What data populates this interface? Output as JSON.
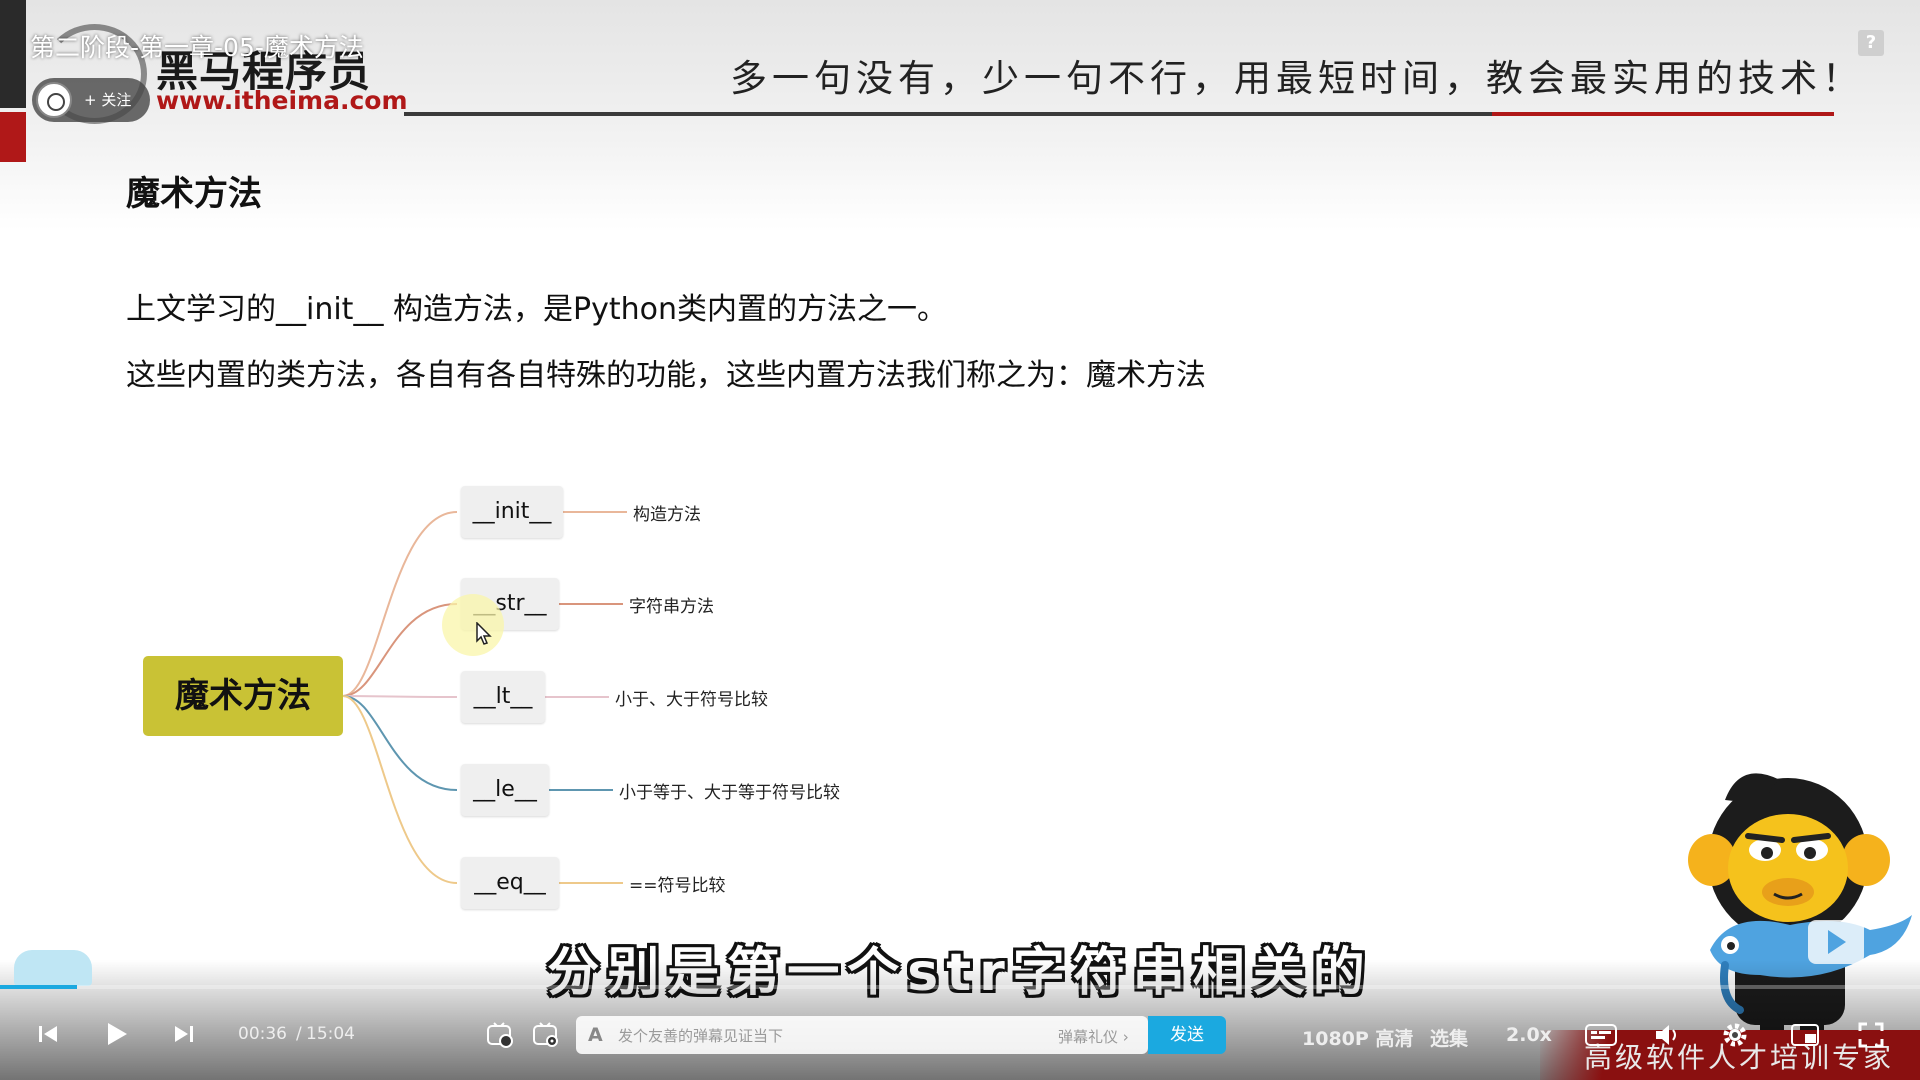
{
  "video": {
    "title": "第二阶段-第一章-05-魔术方法",
    "follow_label": "+ 关注"
  },
  "header": {
    "logo_brand": "黑马程序员",
    "logo_url": "www.itheima.com",
    "slogan": "多一句没有，少一句不行，用最短时间，教会最实用的技术！",
    "help_label": "?"
  },
  "slide": {
    "title": "魔术方法",
    "paragraph1": "上文学习的__init__ 构造方法，是Python类内置的方法之一。",
    "paragraph2": "这些内置的类方法，各自有各自特殊的功能，这些内置方法我们称之为：魔术方法",
    "mindmap": {
      "root": "魔术方法",
      "branches": [
        {
          "label": "__init__",
          "desc": "构造方法",
          "color": "#e9b79a"
        },
        {
          "label": "__str__",
          "desc": "字符串方法",
          "color": "#d9957c"
        },
        {
          "label": "__lt__",
          "desc": "小于、大于符号比较",
          "color": "#e6c4cc"
        },
        {
          "label": "__le__",
          "desc": "小于等于、大于等于符号比较",
          "color": "#5e96b0"
        },
        {
          "label": "__eq__",
          "desc": "==符号比较",
          "color": "#eec98a"
        }
      ]
    }
  },
  "subtitle": "分别是第一个str字符串相关的",
  "player": {
    "current_time": "00:36",
    "separator": "/",
    "total_time": "15:04",
    "progress": 0.04,
    "danmaku_placeholder": "发个友善的弹幕见证当下",
    "danmaku_etiquette": "弹幕礼仪 ›",
    "send_label": "发送",
    "quality_label": "1080P 高清",
    "episodes_label": "选集",
    "speed_label": "2.0x",
    "accent_color": "#1ba9e0"
  },
  "watermark": {
    "ribbon_text": "高级软件人才培训专家"
  }
}
